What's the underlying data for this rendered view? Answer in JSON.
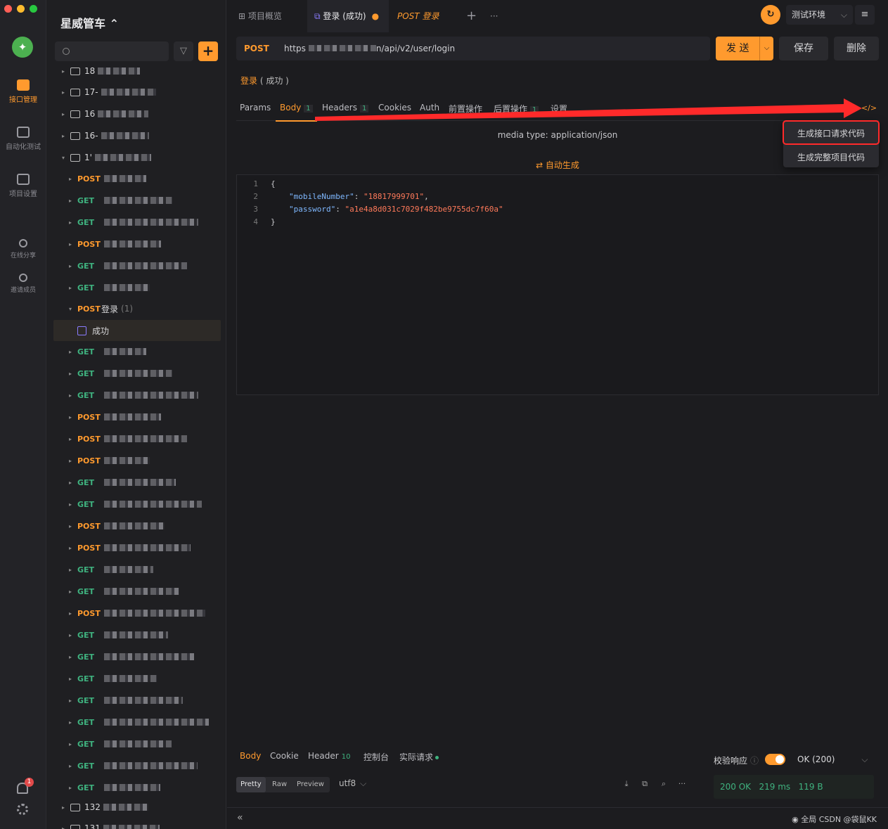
{
  "rail": {
    "items": [
      {
        "label": "接口管理",
        "active": true
      },
      {
        "label": "自动化测试"
      },
      {
        "label": "项目设置"
      },
      {
        "label": "在线分享"
      },
      {
        "label": "邀请成员"
      }
    ],
    "badge": "1"
  },
  "sidebar": {
    "project": "星威管车 ⌃",
    "folders_top": [
      "18",
      "17-",
      "16",
      "16-",
      "1'"
    ],
    "selected_group": {
      "method": "POST",
      "label": "登录",
      "count": "(1)",
      "example": "成功"
    },
    "bottom_folders": [
      "132",
      "131"
    ]
  },
  "tabs": [
    {
      "label": "项目概览",
      "icon": "grid-icon"
    },
    {
      "label": "登录 (成功)",
      "active": true,
      "dirty": true
    },
    {
      "label": "POST 登录"
    }
  ],
  "env": {
    "name": "测试环境"
  },
  "request": {
    "method": "POST",
    "url_prefix": "https",
    "url_suffix": "n/api/v2/user/login",
    "send": "发 送",
    "save": "保存",
    "delete": "删除",
    "name": "登录",
    "name_suffix": "( 成功 )"
  },
  "sub_tabs": [
    {
      "label": "Params"
    },
    {
      "label": "Body",
      "count": "1",
      "active": true
    },
    {
      "label": "Headers",
      "count": "1"
    },
    {
      "label": "Cookies"
    },
    {
      "label": "Auth"
    },
    {
      "label": "前置操作"
    },
    {
      "label": "后置操作",
      "count": "1"
    },
    {
      "label": "设置"
    }
  ],
  "body": {
    "media_type": "media type: application/json",
    "auto_generate": "⇄ 自动生成",
    "lines": [
      "{",
      "\"mobileNumber\": \"18817999701\",",
      "\"password\": \"a1e4a8d031c7029f482be9755dc7f60a\"",
      "}"
    ]
  },
  "code_menu": {
    "items": [
      "生成接口请求代码",
      "生成完整项目代码"
    ]
  },
  "response": {
    "tabs": [
      {
        "label": "Body",
        "active": true
      },
      {
        "label": "Cookie"
      },
      {
        "label": "Header",
        "count": "10"
      },
      {
        "label": "控制台"
      },
      {
        "label": "实际请求"
      }
    ],
    "formats": [
      "Pretty",
      "Raw",
      "Preview"
    ],
    "encoding": "utf8",
    "verify": "校验响应",
    "ok_select": "OK (200)",
    "status": "200 OK",
    "time": "219 ms",
    "size": "119 B"
  },
  "footer": {
    "collapse": "«",
    "text": "全局 CSDN @袋鼠KK"
  },
  "colors": {
    "accent": "#ff9a2e",
    "get": "#3fb27f",
    "annotation": "#ff2a2a"
  }
}
